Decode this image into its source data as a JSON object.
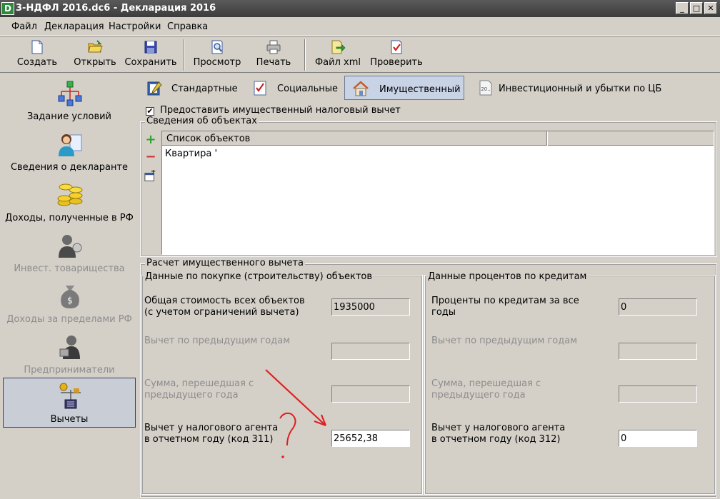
{
  "window": {
    "title": "3-НДФЛ 2016.dc6 - Декларация 2016",
    "app_icon": "D",
    "buttons": [
      "_",
      "□",
      "✕"
    ]
  },
  "menu": [
    "Файл",
    "Декларация",
    "Настройки",
    "Справка"
  ],
  "toolbar": [
    {
      "label": "Создать",
      "icon": "new-document-icon"
    },
    {
      "label": "Открыть",
      "icon": "open-folder-icon"
    },
    {
      "label": "Сохранить",
      "icon": "save-disk-icon"
    },
    {
      "label": "Просмотр",
      "icon": "preview-magnifier-icon"
    },
    {
      "label": "Печать",
      "icon": "printer-icon"
    },
    {
      "label": "Файл xml",
      "icon": "export-xml-icon"
    },
    {
      "label": "Проверить",
      "icon": "check-document-icon"
    }
  ],
  "nav": [
    {
      "label": "Задание условий",
      "enabled": true
    },
    {
      "label": "Сведения о декларанте",
      "enabled": true
    },
    {
      "label": "Доходы, полученные в РФ",
      "enabled": true
    },
    {
      "label": "Инвест. товарищества",
      "enabled": false
    },
    {
      "label": "Доходы за пределами РФ",
      "enabled": false
    },
    {
      "label": "Предприниматели",
      "enabled": false
    },
    {
      "label": "Вычеты",
      "enabled": true,
      "active": true
    }
  ],
  "tabs": [
    {
      "label": "Стандартные"
    },
    {
      "label": "Социальные"
    },
    {
      "label": "Имущественный",
      "active": true
    },
    {
      "label": "Инвестиционный и убытки по ЦБ"
    }
  ],
  "deduction_checkbox": {
    "label": "Предоставить имущественный налоговый вычет",
    "checked": true,
    "mark": "✔"
  },
  "objects": {
    "group_title": "Сведения об объектах",
    "column": "Список объектов",
    "rows": [
      "Квартира ' "
    ],
    "add": "+",
    "remove": "−"
  },
  "calc": {
    "group_title": "Расчет имущественного вычета",
    "left": {
      "title": "Данные по покупке (строительству) объектов",
      "total_label": "Общая стоимость всех объектов (с учетом ограничений вычета)",
      "total_value": "1935000",
      "prev_label": "Вычет по предыдущим годам",
      "prev_value": "",
      "carry_label": "Сумма, перешедшая с предыдущего года",
      "carry_value": "",
      "agent_label": "Вычет у налогового агента в отчетном году (код 311)",
      "agent_value": "25652,38"
    },
    "right": {
      "title": "Данные процентов по кредитам",
      "total_label": "Проценты по кредитам за все годы",
      "total_value": "0",
      "prev_label": "Вычет по предыдущим годам",
      "prev_value": "",
      "carry_label": "Сумма, перешедшая с предыдущего года",
      "carry_value": "",
      "agent_label": "Вычет у налогового агента в отчетном году (код 312)",
      "agent_value": "0"
    }
  },
  "colors": {
    "window_bg": "#d4d0c8",
    "titlebar": "#3c3c3c",
    "active_tab": "#c8d4e6",
    "annotation": "#e02020",
    "add_icon": "#2ea02e",
    "remove_icon": "#d03030"
  }
}
